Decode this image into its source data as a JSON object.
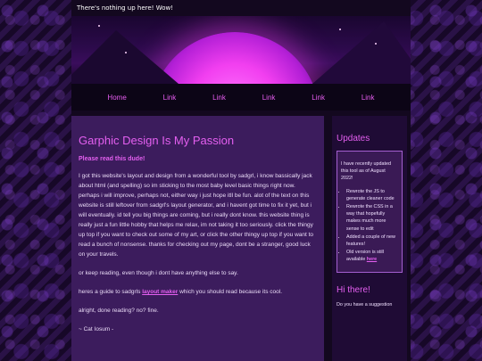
{
  "topbar": {
    "text": "There's nothing up here! Wow!"
  },
  "nav": {
    "items": [
      {
        "label": "Home"
      },
      {
        "label": "Link"
      },
      {
        "label": "Link"
      },
      {
        "label": "Link"
      },
      {
        "label": "Link"
      },
      {
        "label": "Link"
      }
    ]
  },
  "main": {
    "title": "Garphic Design Is My Passion",
    "subtitle": "Please read this dude!",
    "paragraph1": "I got this website's layout and design from a wonderful tool by sadgrl, i know bassically jack about html (and spelling) so im sticking to the most baby level basic things right now. perhaps i will improve, perhaps not, either way i just hope itll be fun. alot of the text on this website is still leftover from sadgrl's layout generator, and i havent got time to fix it yet, but i will eventually. id tell you big things are coming, but i really dont know. this website thing is really just a fun little hobby that helps me relax, im not taking it too seriously. click the thingy up top if you want to check out some of my art, or click the other thingy up top if you want to read a bunch of nonsense. thanks for checking out my page, dont be a stranger, good luck on your travels.",
    "paragraph2": "or keep reading, even though i dont have anything else to say.",
    "paragraph3_before": "heres a guide to sadgrls ",
    "paragraph3_link": "layout maker",
    "paragraph3_after": " which you should read because its cool.",
    "paragraph4": "alright, done reading? no? fine.",
    "signature": "~ Cat Iosum -"
  },
  "sidebar": {
    "updates_title": "Updates",
    "updates_intro": "I have recently updated this tool as of August 2022!",
    "updates_items": [
      "Rewrote the JS to generate cleaner code",
      "Rewrote the CSS in a way that hopefully makes much more sense to edit",
      "Added a couple of new features!"
    ],
    "updates_last_before": "Old version is still available ",
    "updates_last_link": "here",
    "hi_title": "Hi there!",
    "hi_text": "Do you have a suggestion"
  },
  "colors": {
    "accent": "#e45ff0",
    "main_bg": "#3c1c5d",
    "sidebar_bg": "#1f0b35"
  }
}
